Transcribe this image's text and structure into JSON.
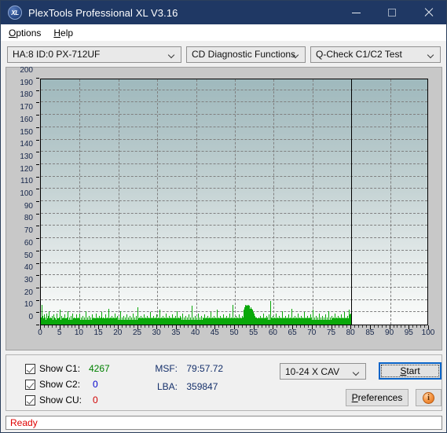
{
  "window": {
    "title": "PlexTools Professional XL V3.16",
    "icon": "XL",
    "controls": {
      "minimize": "minimize-icon",
      "maximize": "maximize-icon",
      "close": "close-icon"
    },
    "titlebar_color": "#1f3864"
  },
  "menubar": {
    "items": [
      {
        "label": "Options",
        "accel": "O"
      },
      {
        "label": "Help",
        "accel": "H"
      }
    ]
  },
  "toolbar": {
    "drive": {
      "value": "HA:8 ID:0  PX-712UF"
    },
    "function": {
      "value": "CD Diagnostic Functions"
    },
    "test": {
      "value": "Q-Check C1/C2 Test"
    }
  },
  "controls": {
    "checkboxes": [
      {
        "label": "Show C1:",
        "checked": true,
        "value": "4267",
        "color": "#008000"
      },
      {
        "label": "Show C2:",
        "checked": true,
        "value": "0",
        "color": "#0000cd"
      },
      {
        "label": "Show CU:",
        "checked": true,
        "value": "0",
        "color": "#d00000"
      }
    ],
    "readouts": [
      {
        "key": "MSF:",
        "value": "79:57.72"
      },
      {
        "key": "LBA:",
        "value": "359847"
      }
    ],
    "speed": {
      "value": "10-24 X CAV"
    },
    "start_label": "Start",
    "start_accel": "S",
    "preferences_label": "Preferences",
    "preferences_accel": "P",
    "info_label": "i"
  },
  "statusbar": {
    "text": "Ready",
    "color": "#e00000"
  },
  "chart_data": {
    "type": "bar",
    "title": "Q-Check C1/C2 Test",
    "xlabel": "",
    "ylabel": "",
    "xlim": [
      0,
      100
    ],
    "ylim": [
      0,
      200
    ],
    "grid": true,
    "legend_position": "bottom-left",
    "x_ticks": [
      0,
      5,
      10,
      15,
      20,
      25,
      30,
      35,
      40,
      45,
      50,
      55,
      60,
      65,
      70,
      75,
      80,
      85,
      90,
      95,
      100
    ],
    "y_ticks": [
      0,
      10,
      20,
      30,
      40,
      50,
      60,
      70,
      80,
      90,
      100,
      110,
      120,
      130,
      140,
      150,
      160,
      170,
      180,
      190,
      200
    ],
    "x_minor_step": 1,
    "annotations": [
      {
        "type": "vline",
        "x": 80,
        "label": "disc-end-marker",
        "color": "#000000"
      }
    ],
    "series": [
      {
        "name": "C1",
        "color": "#0aa80a",
        "data_span": [
          0,
          80
        ],
        "values": [
          6,
          16,
          9,
          7,
          4,
          5,
          8,
          6,
          5,
          4,
          6,
          9,
          5,
          4,
          7,
          11,
          5,
          4,
          6,
          5,
          4,
          7,
          5,
          4,
          5,
          8,
          6,
          4,
          5,
          4,
          6,
          9,
          5,
          4,
          5,
          6,
          12,
          5,
          4,
          5,
          7,
          5,
          4,
          6,
          5,
          4,
          8,
          5,
          4,
          5,
          6,
          11,
          5,
          4,
          6,
          5,
          4,
          5,
          7,
          4,
          5,
          9,
          5,
          4,
          6,
          5,
          4,
          5,
          8,
          4,
          5,
          6,
          4,
          5,
          9,
          5,
          4,
          6,
          5,
          4,
          7,
          5,
          4,
          5,
          6,
          4,
          5,
          11,
          4,
          5,
          6,
          4,
          5,
          7,
          4,
          5,
          6,
          4,
          5,
          8,
          5,
          4,
          6,
          5,
          4,
          5,
          9,
          4,
          5,
          6,
          4,
          5,
          7,
          4,
          5,
          6,
          4,
          10,
          5,
          4,
          6,
          5,
          4,
          5,
          8,
          4,
          5,
          6,
          4,
          5,
          13,
          4,
          5,
          6,
          4,
          5,
          7,
          4,
          5,
          6,
          4,
          5,
          9,
          4,
          5,
          6,
          4,
          5,
          7,
          4,
          5,
          6,
          4,
          5,
          11,
          4,
          5,
          6,
          4,
          5,
          7,
          4,
          5,
          6,
          4,
          5,
          8,
          4,
          5,
          6,
          4,
          5,
          7,
          4,
          5,
          6,
          4,
          5,
          9,
          4,
          5,
          6,
          4,
          5,
          7,
          4,
          5,
          14,
          4,
          5,
          6,
          4,
          5,
          7,
          4,
          5,
          6,
          4,
          5,
          8,
          4,
          5,
          6,
          4,
          5,
          7,
          4,
          5,
          6,
          4,
          5,
          10,
          4,
          5,
          6,
          4,
          5,
          7,
          4,
          5,
          6,
          4,
          5,
          8,
          4,
          5,
          6,
          4,
          5,
          12,
          4,
          5,
          6,
          4,
          5,
          7,
          4,
          5,
          6,
          4,
          5,
          9,
          4,
          5,
          6,
          4,
          5,
          7,
          4,
          5,
          6,
          4,
          5,
          8,
          4,
          5,
          6,
          4,
          5,
          7,
          4,
          5,
          11,
          4,
          5,
          6,
          4,
          5,
          7,
          4,
          5,
          6,
          4,
          5,
          9,
          4,
          5,
          6,
          4,
          5,
          7,
          4,
          5,
          6,
          4,
          5,
          8,
          4,
          5,
          6,
          4,
          5,
          15,
          4,
          5,
          6,
          4,
          5,
          7,
          4,
          5,
          6,
          4,
          5,
          9,
          4,
          5,
          6,
          4,
          5,
          7,
          4,
          5,
          6,
          4,
          5,
          8,
          4,
          5,
          6,
          4,
          5,
          7,
          4,
          5,
          6,
          4,
          5,
          10,
          4,
          5,
          6,
          4,
          5,
          7,
          4,
          5,
          6,
          4,
          5,
          12,
          4,
          5,
          6,
          4,
          5,
          7,
          4,
          5,
          6,
          4,
          5,
          8,
          4,
          5,
          6,
          4,
          5,
          7,
          4,
          5,
          6,
          4,
          5,
          9,
          4,
          5,
          6,
          4,
          5,
          16,
          4,
          5,
          6,
          4,
          5,
          7,
          4,
          5,
          6,
          4,
          5,
          8,
          4,
          5,
          6,
          4,
          5,
          7,
          4,
          6,
          9,
          12,
          14,
          16,
          13,
          15,
          14,
          16,
          15,
          13,
          16,
          14,
          15,
          13,
          14,
          12,
          13,
          11,
          12,
          10,
          9,
          8,
          7,
          6,
          5,
          6,
          5,
          4,
          5,
          6,
          4,
          5,
          7,
          4,
          5,
          6,
          4,
          5,
          9,
          4,
          5,
          6,
          4,
          5,
          7,
          4,
          5,
          6,
          4,
          5,
          8,
          4,
          5,
          19,
          6,
          4,
          5,
          7,
          4,
          5,
          6,
          4,
          5,
          9,
          4,
          5,
          6,
          4,
          5,
          7,
          4,
          5,
          6,
          4,
          5,
          11,
          4,
          5,
          6,
          4,
          5,
          7,
          4,
          5,
          6,
          4,
          5,
          8,
          4,
          5,
          6,
          4,
          5,
          13,
          4,
          5,
          6,
          4,
          5,
          7,
          4,
          5,
          6,
          4,
          5,
          9,
          4,
          5,
          6,
          4,
          5,
          7,
          4,
          5,
          6,
          4,
          5,
          10,
          4,
          5,
          6,
          4,
          5,
          7,
          4,
          5,
          6,
          4,
          5,
          8,
          4,
          5,
          6,
          4,
          5,
          12,
          4,
          5,
          6,
          4,
          5,
          7,
          4,
          5,
          6,
          4,
          5,
          9,
          4,
          5,
          6,
          4,
          5,
          7,
          4,
          5,
          6,
          4,
          5,
          8,
          4,
          5,
          6,
          4,
          5,
          11,
          4,
          5,
          6,
          4,
          5,
          7,
          4,
          5,
          6,
          4,
          5,
          9,
          4,
          5,
          6,
          4,
          5,
          7,
          4,
          5,
          6,
          4,
          5,
          8,
          4,
          5,
          6,
          4,
          5,
          10,
          4,
          5,
          6,
          4,
          5,
          7,
          4,
          5,
          12,
          8,
          7,
          9,
          6
        ]
      }
    ]
  }
}
